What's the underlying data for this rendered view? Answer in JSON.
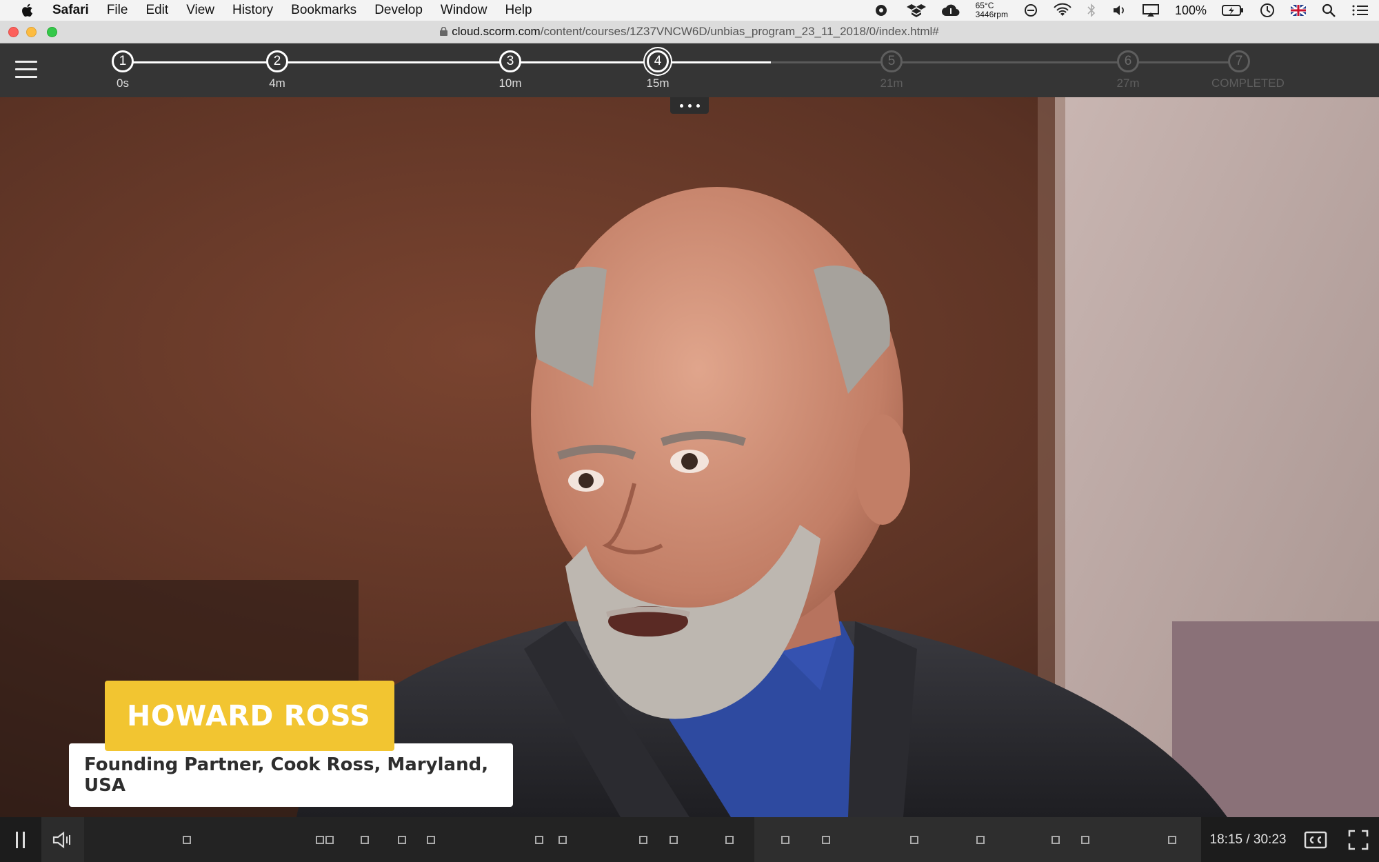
{
  "menubar": {
    "app_name": "Safari",
    "items": [
      "File",
      "Edit",
      "View",
      "History",
      "Bookmarks",
      "Develop",
      "Window",
      "Help"
    ],
    "temperature": "65°C",
    "fan_speed": "3446rpm",
    "battery": "100%"
  },
  "browser": {
    "url_host": "cloud.scorm.com",
    "url_path": "/content/courses/1Z37VNCW6D/unbias_program_23_11_2018/0/index.html#"
  },
  "course": {
    "progress_fraction": 0.58,
    "milestones": [
      {
        "number": "1",
        "label": "0s",
        "state": "done"
      },
      {
        "number": "2",
        "label": "4m",
        "state": "done"
      },
      {
        "number": "3",
        "label": "10m",
        "state": "done"
      },
      {
        "number": "4",
        "label": "15m",
        "state": "current"
      },
      {
        "number": "5",
        "label": "21m",
        "state": "future"
      },
      {
        "number": "6",
        "label": "27m",
        "state": "future"
      },
      {
        "number": "7",
        "label": "COMPLETED",
        "state": "future"
      }
    ]
  },
  "video": {
    "speaker_name": "HOWARD ROSS",
    "speaker_title": "Founding Partner, Cook Ross, Maryland, USA"
  },
  "player": {
    "time_display": "18:15 / 30:23",
    "played_fraction": 0.6
  },
  "colors": {
    "name_banner": "#f2c531",
    "header_bg": "#353535",
    "controls_bg": "#1c1c1c"
  }
}
